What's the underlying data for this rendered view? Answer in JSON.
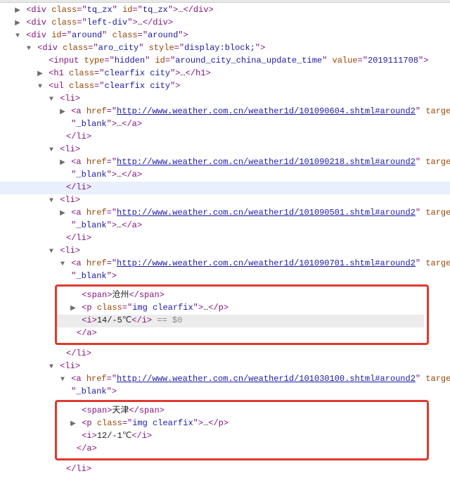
{
  "topDivs": [
    {
      "class": "tq_zx",
      "id": "tq_zx"
    },
    {
      "class": "left-div"
    }
  ],
  "aroundDiv": {
    "id": "around",
    "class": "around"
  },
  "aroCity": {
    "class": "aro_city",
    "style": "display:block;"
  },
  "hiddenInput": {
    "type": "hidden",
    "id": "around_city_china_update_time",
    "value": "2019111708"
  },
  "h1": {
    "class": "clearfix city"
  },
  "ul": {
    "class": "clearfix city"
  },
  "target": "_blank",
  "ellipsis": "…",
  "dollar0": " == $0",
  "pImg": {
    "class": "img clearfix"
  },
  "items": [
    {
      "href": "http://www.weather.com.cn/weather1d/101090604.shtml#around2"
    },
    {
      "href": "http://www.weather.com.cn/weather1d/101090218.shtml#around2"
    },
    {
      "href": "http://www.weather.com.cn/weather1d/101090501.shtml#around2"
    },
    {
      "href": "http://www.weather.com.cn/weather1d/101090701.shtml#around2",
      "city": "沧州",
      "temp": "14/-5℃"
    },
    {
      "href": "http://www.weather.com.cn/weather1d/101030100.shtml#around2",
      "city": "天津",
      "temp": "12/-1℃"
    }
  ],
  "tags": {
    "divOpen": "div",
    "divClose": "/div",
    "liOpen": "li",
    "liClose": "/li",
    "aOpen": "a",
    "aClose": "/a",
    "ulOpen": "ul",
    "h1Open": "h1",
    "h1Close": "/h1",
    "spanOpen": "span",
    "spanClose": "/span",
    "pOpen": "p",
    "pClose": "/p",
    "iOpen": "i",
    "iClose": "/i",
    "inputOpen": "input"
  },
  "attrs": {
    "class": "class",
    "id": "id",
    "style": "style",
    "type": "type",
    "value": "value",
    "href": "href",
    "target": "target"
  }
}
